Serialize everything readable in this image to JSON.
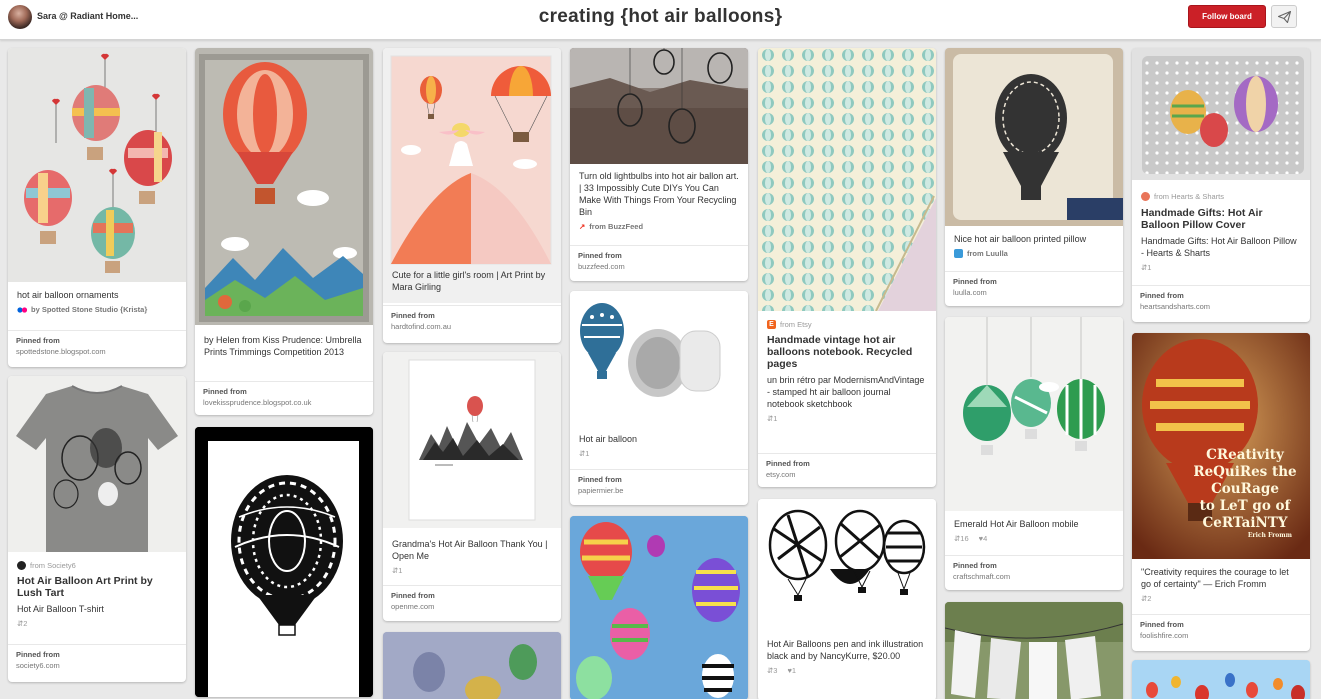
{
  "header": {
    "user_name": "Sara @ Radiant Home...",
    "board_title": "creating {hot air balloons}",
    "follow_label": "Follow board",
    "accent": "#cb2027"
  },
  "pins": [
    {
      "id": "c1p1",
      "desc": "hot air balloon ornaments",
      "source": "by Spotted Stone Studio {Krista}",
      "pinned_label": "Pinned from",
      "domain": "spottedstone.blogspot.com"
    },
    {
      "id": "c1p2",
      "source": "from Society6",
      "title": "Hot Air Balloon Art Print by Lush Tart",
      "desc": "Hot Air Balloon T-shirt",
      "repins": "2",
      "pinned_label": "Pinned from",
      "domain": "society6.com"
    },
    {
      "id": "c2p1",
      "desc": "by Helen from Kiss Prudence: Umbrella Prints Trimmings Competition 2013",
      "pinned_label": "Pinned from",
      "domain": "lovekissprudence.blogspot.co.uk"
    },
    {
      "id": "c3p1",
      "desc": "Cute for a little girl's room | Art Print by Mara Girling",
      "pinned_label": "Pinned from",
      "domain": "hardtofind.com.au"
    },
    {
      "id": "c3p2",
      "desc": "Grandma's Hot Air Balloon Thank You | Open Me",
      "repins": "1",
      "pinned_label": "Pinned from",
      "domain": "openme.com"
    },
    {
      "id": "c4p1",
      "desc": "Turn old lightbulbs into hot air ballon art. | 33 Impossibly Cute DIYs You Can Make With Things From Your Recycling Bin",
      "source": "from BuzzFeed",
      "pinned_label": "Pinned from",
      "domain": "buzzfeed.com"
    },
    {
      "id": "c4p2",
      "desc": "Hot air balloon",
      "repins": "1",
      "pinned_label": "Pinned from",
      "domain": "papiermier.be"
    },
    {
      "id": "c5p1",
      "source": "from Etsy",
      "title": "Handmade vintage hot air balloons notebook. Recycled pages",
      "desc": "un brin rétro par ModernismAndVintage - stamped ht air balloon journal notebook sketchbook",
      "repins": "1",
      "pinned_label": "Pinned from",
      "domain": "etsy.com"
    },
    {
      "id": "c5p2",
      "desc": "Hot Air Balloons pen and ink illustration black and by NancyKurre, $20.00",
      "repins": "3",
      "likes": "1"
    },
    {
      "id": "c6p1",
      "desc": "Nice hot air balloon printed pillow",
      "source": "from Luulla",
      "pinned_label": "Pinned from",
      "domain": "luulla.com"
    },
    {
      "id": "c6p2",
      "desc": "Emerald Hot Air Balloon mobile",
      "repins": "16",
      "likes": "4",
      "pinned_label": "Pinned from",
      "domain": "craftschmaft.com"
    },
    {
      "id": "c7p1",
      "source": "from Hearts & Sharts",
      "title": "Handmade Gifts: Hot Air Balloon Pillow Cover",
      "desc": "Handmade Gifts: Hot Air Balloon Pillow - Hearts & Sharts",
      "repins": "1",
      "pinned_label": "Pinned from",
      "domain": "heartsandsharts.com"
    },
    {
      "id": "c7p2",
      "desc": "\"Creativity requires the courage to let go of certainty\" — Erich Fromm",
      "repins": "2",
      "pinned_label": "Pinned from",
      "domain": "foolishfire.com",
      "poster_lines": [
        "CReativity",
        "ReQuiRes the",
        "CouRage",
        "to LeT go of",
        "CeRTaiNTY"
      ],
      "poster_author": "Erich Fromm"
    }
  ]
}
